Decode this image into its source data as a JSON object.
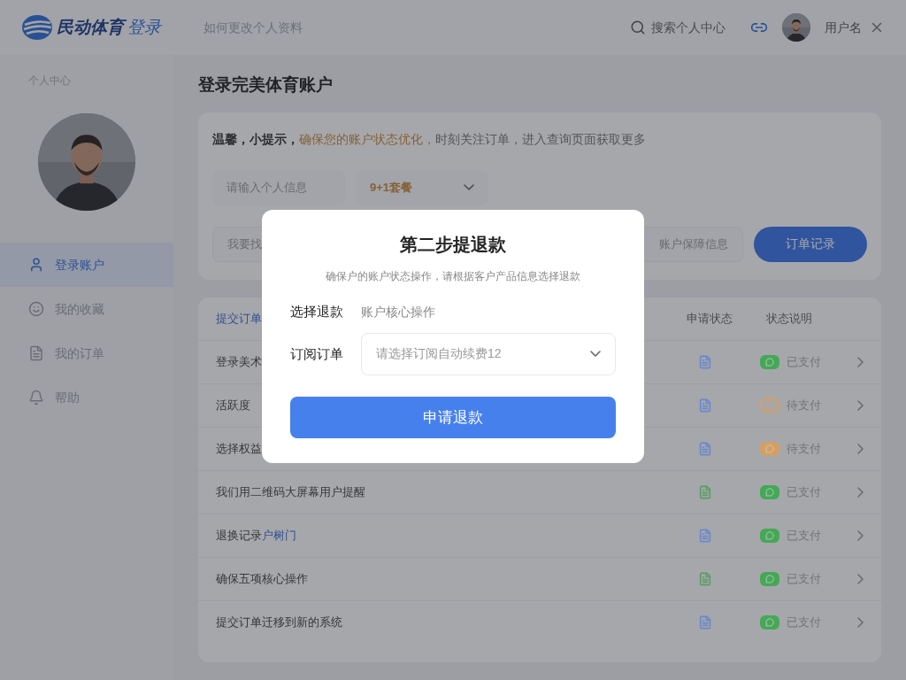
{
  "header": {
    "logo_text": "民动体育",
    "logo_suffix": "登录",
    "search_placeholder": "如何更改个人资料",
    "quick_search": "搜索个人中心",
    "user_name": "用户名"
  },
  "sidebar": {
    "label": "个人中心",
    "items": [
      {
        "label": "登录账户",
        "selected": true
      },
      {
        "label": "我的收藏",
        "selected": false
      },
      {
        "label": "我的订单",
        "selected": false
      },
      {
        "label": "帮助",
        "selected": false
      }
    ]
  },
  "page_title": "登录完美体育账户",
  "tip": [
    {
      "kind": "strong",
      "text": "温馨，小提示，"
    },
    {
      "kind": "warn",
      "text": "确保您的账户状态优化，"
    },
    {
      "kind": "plain",
      "text": "时刻关注订单，进入查询页面获取更多"
    }
  ],
  "filters": {
    "name_placeholder": "请输入个人信息",
    "promo": "9+1套餐",
    "keyword_placeholder": "我要找",
    "guard_placeholder": "账户保障信息",
    "records_button": "订单记录"
  },
  "table": {
    "columns": [
      "提交订单",
      "申请状态",
      "状态说明"
    ],
    "rows": [
      {
        "title": "登录美术",
        "icon": {
          "color": "#6a88cc"
        },
        "badge": {
          "kind": "solid",
          "color": "#45a857"
        },
        "status": "已支付"
      },
      {
        "title": "活跃度",
        "icon": {
          "color": "#6a88cc"
        },
        "badge": {
          "kind": "outline",
          "color": "#d4a062"
        },
        "status": "待支付"
      },
      {
        "title": "选择权益",
        "icon": {
          "color": "#6a88cc"
        },
        "badge": {
          "kind": "solid",
          "color": "#d4a062"
        },
        "status": "待支付"
      },
      {
        "title": "我们用二维码大屏幕用户提醒",
        "icon": {
          "color": "#5a9e66"
        },
        "badge": {
          "kind": "solid",
          "color": "#45a857"
        },
        "status": "已支付"
      },
      {
        "title": "退换记录",
        "title_link": "户树门",
        "icon": {
          "color": "#6a88cc"
        },
        "badge": {
          "kind": "solid",
          "color": "#45a857"
        },
        "status": "已支付"
      },
      {
        "title": "确保五项核心操作",
        "icon": {
          "color": "#5a9e66"
        },
        "badge": {
          "kind": "solid",
          "color": "#45a857"
        },
        "status": "已支付"
      },
      {
        "title": "提交订单迁移到新的系统",
        "icon": {
          "color": "#6a88cc"
        },
        "badge": {
          "kind": "solid",
          "color": "#45a857"
        },
        "status": "已支付"
      }
    ]
  },
  "modal": {
    "title": "第二步提退款",
    "description": "确保户的账户状态操作，请根据客户产品信息选择退款",
    "fields": [
      {
        "kind": "text",
        "label": "选择退款",
        "value": "账户核心操作"
      },
      {
        "kind": "select",
        "label": "订阅订单",
        "value": "请选择订阅自动续费12"
      }
    ],
    "submit": "申请退款"
  }
}
